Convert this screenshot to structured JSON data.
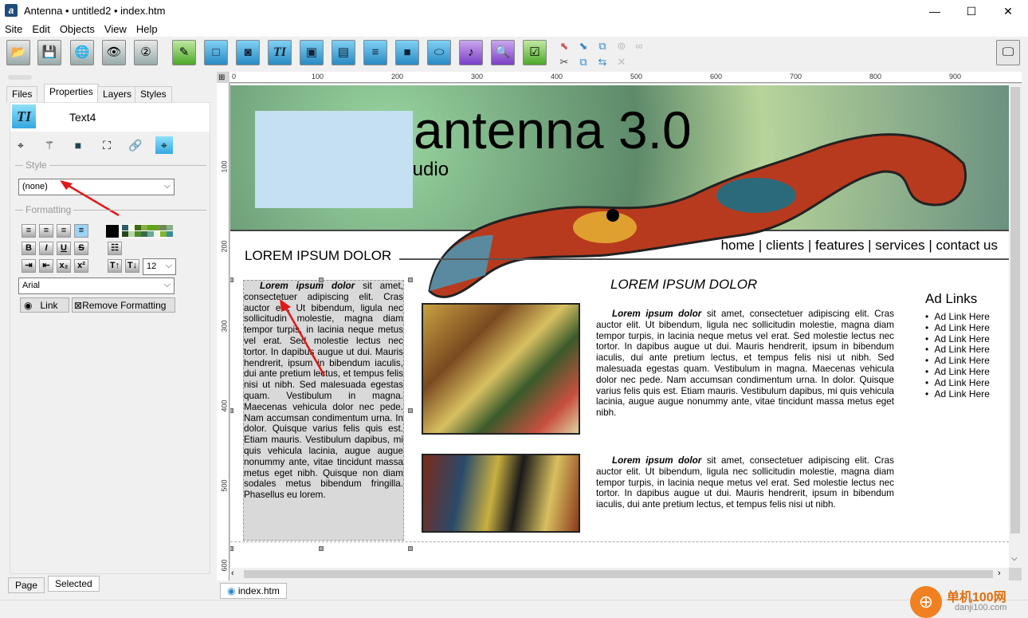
{
  "window": {
    "title": "Antenna • untitled2 • index.htm",
    "app_icon": "a",
    "minimize": "—",
    "maximize": "☐",
    "close": "✕"
  },
  "menu": [
    "Site",
    "Edit",
    "Objects",
    "View",
    "Help"
  ],
  "toolbar": {
    "icons": [
      "open-folder",
      "save",
      "publish-globe",
      "preview-eye",
      "history",
      "edit-pencil",
      "box",
      "image-camera",
      "text",
      "image-gallery",
      "form",
      "line",
      "gradient-box",
      "ellipse",
      "media-music",
      "search",
      "checkbox"
    ],
    "small_icons": [
      "arrow-up-left",
      "arrow-down-right",
      "copy-frame",
      "lock",
      "link",
      "cut",
      "copy",
      "paste",
      "delete"
    ],
    "right_icon": "monitor"
  },
  "left_panel": {
    "tabs": [
      "Files",
      "Properties",
      "Layers",
      "Styles"
    ],
    "active_tab": "Properties",
    "object_name": "Text4",
    "style_label": "Style",
    "style_value": "(none)",
    "formatting_label": "Formatting",
    "font_size": "12",
    "font": "Arial",
    "link_button": "Link",
    "remove_formatting_button": "Remove Formatting",
    "bottom_tabs": [
      "Page",
      "Selected"
    ],
    "swatch_colors": [
      "#000000",
      "#2f5b6b",
      "#f4f8e4",
      "#3d6b16",
      "#8aae48",
      "#5ea41c",
      "#6a9e2a",
      "#6c8a58",
      "#8ab088",
      "#24461a",
      "#b8d8a0",
      "#4c8c2c",
      "#3a6a4a",
      "#6aa898",
      "#eef4e8",
      "#7cb82c",
      "#3a8c9c"
    ]
  },
  "ruler": {
    "h": [
      "0",
      "100",
      "200",
      "300",
      "400",
      "500",
      "600",
      "700",
      "800",
      "900"
    ],
    "v": [
      "100",
      "200",
      "300",
      "400",
      "500",
      "600"
    ]
  },
  "page": {
    "banner_title": "antenna 3.0",
    "banner_subtitle": "studio",
    "nav": "home | clients | features | services | contact us",
    "left_heading": "LOREM IPSUM DOLOR",
    "left_text_bold": "Lorem ipsum dolor",
    "left_text": " sit amet, consectetuer adipiscing elit. Cras auctor elit. Ut bibendum, ligula nec sollicitudin molestie, magna diam tempor turpis, in lacinia neque metus vel erat. Sed molestie lectus nec tortor. In dapibus augue ut dui. Mauris hendrerit, ipsum in bibendum iaculis, dui ante pretium lectus, et tempus felis nisi ut nibh. Sed malesuada egestas quam. Vestibulum in magna. Maecenas vehicula dolor nec pede. Nam accumsan condimentum urna. In dolor. Quisque varius felis quis est. Etiam mauris. Vestibulum dapibus, mi quis vehicula lacinia, augue augue nonummy ante, vitae tincidunt massa metus eget nibh. Quisque non diam sodales metus bibendum fringilla. Phasellus eu lorem.",
    "main_heading": "LOREM IPSUM DOLOR",
    "para1_bold": "Lorem ipsum dolor",
    "para1": " sit amet, consectetuer adipiscing elit. Cras auctor elit. Ut bibendum, ligula nec sollicitudin molestie, magna diam tempor turpis, in lacinia neque metus vel erat. Sed molestie lectus nec tortor. In dapibus augue ut dui. Mauris hendrerit, ipsum in bibendum iaculis, dui ante pretium lectus, et tempus felis nisi ut nibh. Sed malesuada egestas quam. Vestibulum in magna. Maecenas vehicula dolor nec pede. Nam accumsan condimentum urna. In dolor. Quisque varius felis quis est. Etiam mauris. Vestibulum dapibus, mi quis vehicula lacinia, augue augue nonummy ante, vitae tincidunt massa metus eget nibh.",
    "para2_bold": "Lorem ipsum dolor",
    "para2": " sit amet, consectetuer adipiscing elit. Cras auctor elit. Ut bibendum, ligula nec sollicitudin molestie, magna diam tempor turpis, in lacinia neque metus vel erat. Sed molestie lectus nec tortor. In dapibus augue ut dui. Mauris hendrerit, ipsum in bibendum iaculis, dui ante pretium lectus, et tempus felis nisi ut nibh.",
    "ads_heading": "Ad Links",
    "ads": [
      "Ad Link Here",
      "Ad Link Here",
      "Ad Link Here",
      "Ad Link Here",
      "Ad Link Here",
      "Ad Link Here",
      "Ad Link Here",
      "Ad Link Here"
    ]
  },
  "doc_tab": "index.htm",
  "watermark": {
    "text": "单机100网",
    "url": "danji100.com"
  }
}
